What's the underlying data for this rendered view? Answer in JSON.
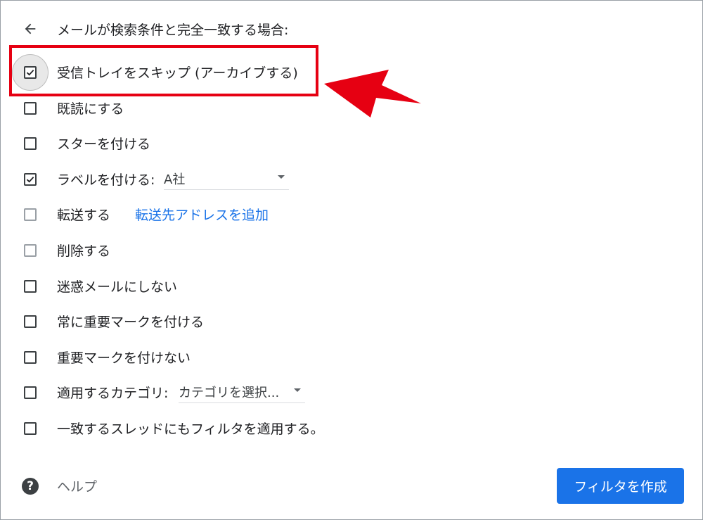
{
  "header": {
    "title": "メールが検索条件と完全一致する場合:"
  },
  "actions": [
    {
      "label": "受信トレイをスキップ (アーカイブする)",
      "checked": true
    },
    {
      "label": "既読にする",
      "checked": false
    },
    {
      "label": "スターを付ける",
      "checked": false
    },
    {
      "label": "ラベルを付ける:",
      "checked": true,
      "select_value": "A社"
    },
    {
      "label": "転送する",
      "checked": false,
      "link_label": "転送先アドレスを追加"
    },
    {
      "label": "削除する",
      "checked": false
    },
    {
      "label": "迷惑メールにしない",
      "checked": false
    },
    {
      "label": "常に重要マークを付ける",
      "checked": false
    },
    {
      "label": "重要マークを付けない",
      "checked": false
    },
    {
      "label": "適用するカテゴリ:",
      "checked": false,
      "select_value": "カテゴリを選択..."
    },
    {
      "label": "一致するスレッドにもフィルタを適用する。",
      "checked": false
    }
  ],
  "footer": {
    "help_label": "ヘルプ",
    "create_button": "フィルタを作成"
  },
  "colors": {
    "accent": "#1a73e8",
    "highlight": "#e60012",
    "text": "#202124"
  },
  "icons": {
    "back": "arrow-left-icon",
    "help": "help-circle-icon",
    "check": "checkmark-icon",
    "annotation": "red-arrow-icon"
  }
}
